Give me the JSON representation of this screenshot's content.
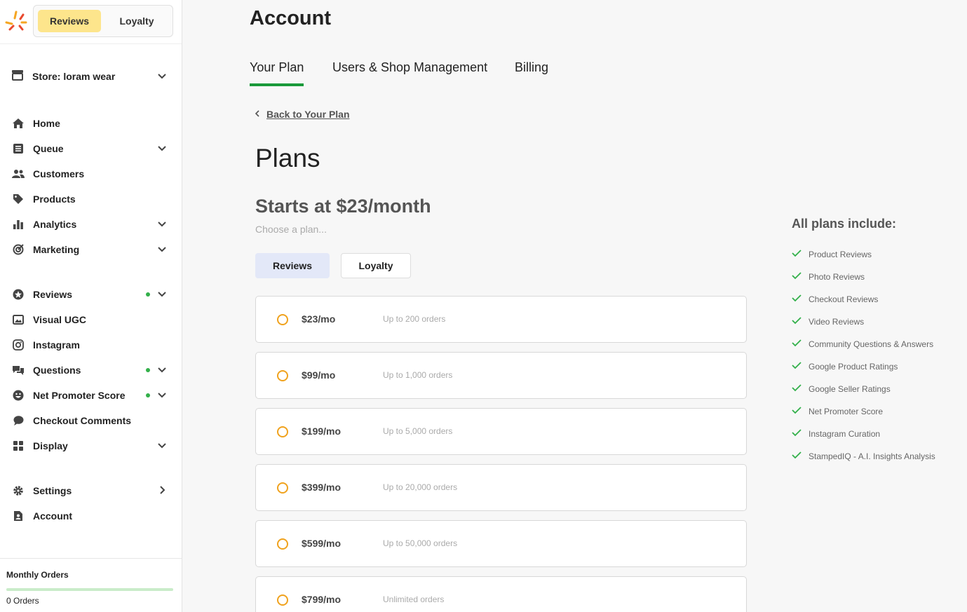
{
  "app_switch": {
    "reviews": "Reviews",
    "loyalty": "Loyalty"
  },
  "store": {
    "label": "Store: loram wear"
  },
  "nav": {
    "home": "Home",
    "queue": "Queue",
    "customers": "Customers",
    "products": "Products",
    "analytics": "Analytics",
    "marketing": "Marketing",
    "reviews": "Reviews",
    "visual_ugc": "Visual UGC",
    "instagram": "Instagram",
    "questions": "Questions",
    "nps": "Net Promoter Score",
    "checkout_comments": "Checkout Comments",
    "display": "Display",
    "settings": "Settings",
    "account": "Account"
  },
  "monthly_orders": {
    "title": "Monthly Orders",
    "count": "0 Orders",
    "progress": 0
  },
  "page": {
    "title": "Account"
  },
  "tabs": {
    "your_plan": "Your Plan",
    "users": "Users & Shop Management",
    "billing": "Billing"
  },
  "back_link": "Back to Your Plan",
  "plans": {
    "title": "Plans",
    "starts": "Starts at $23/month",
    "choose": "Choose a plan...",
    "seg_reviews": "Reviews",
    "seg_loyalty": "Loyalty",
    "options": [
      {
        "price": "$23/mo",
        "orders": "Up to 200 orders"
      },
      {
        "price": "$99/mo",
        "orders": "Up to 1,000 orders"
      },
      {
        "price": "$199/mo",
        "orders": "Up to 5,000 orders"
      },
      {
        "price": "$399/mo",
        "orders": "Up to 20,000 orders"
      },
      {
        "price": "$599/mo",
        "orders": "Up to 50,000 orders"
      },
      {
        "price": "$799/mo",
        "orders": "Unlimited orders"
      }
    ]
  },
  "includes": {
    "title": "All plans include:",
    "items": [
      "Product Reviews",
      "Photo Reviews",
      "Checkout Reviews",
      "Video Reviews",
      "Community Questions & Answers",
      "Google Product Ratings",
      "Google Seller Ratings",
      "Net Promoter Score",
      "Instagram Curation",
      "StampedIQ - A.I. Insights Analysis"
    ]
  },
  "colors": {
    "accent_green": "#1a9a3a",
    "radio_orange": "#f0a21d",
    "active_app": "#fde58c"
  }
}
